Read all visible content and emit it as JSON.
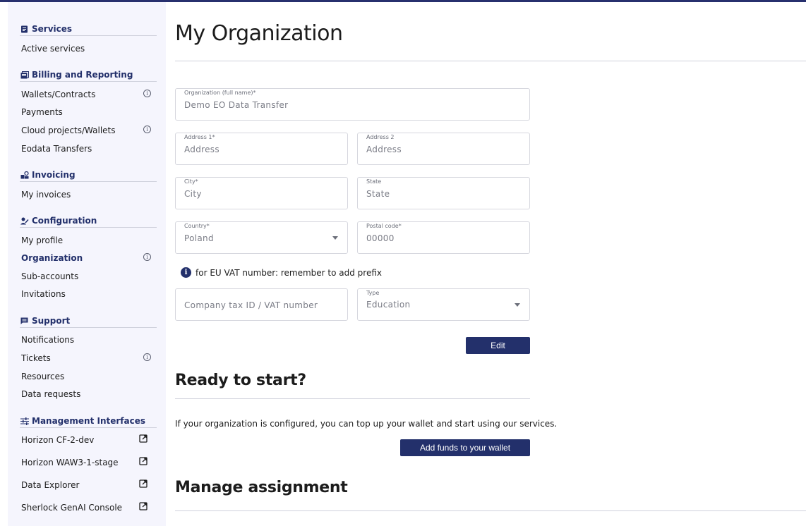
{
  "sidebar": {
    "sections": [
      {
        "title": "Services",
        "icon": "services-icon",
        "items": [
          {
            "label": "Active services"
          }
        ]
      },
      {
        "title": "Billing and Reporting",
        "icon": "billing-icon",
        "items": [
          {
            "label": "Wallets/Contracts",
            "info": true
          },
          {
            "label": "Payments"
          },
          {
            "label": "Cloud projects/Wallets",
            "info": true
          },
          {
            "label": "Eodata Transfers"
          }
        ]
      },
      {
        "title": "Invoicing",
        "icon": "invoicing-icon",
        "items": [
          {
            "label": "My invoices"
          }
        ]
      },
      {
        "title": "Configuration",
        "icon": "configuration-icon",
        "items": [
          {
            "label": "My profile"
          },
          {
            "label": "Organization",
            "info": true,
            "active": true
          },
          {
            "label": "Sub-accounts"
          },
          {
            "label": "Invitations"
          }
        ]
      },
      {
        "title": "Support",
        "icon": "support-icon",
        "items": [
          {
            "label": "Notifications"
          },
          {
            "label": "Tickets",
            "info": true
          },
          {
            "label": "Resources"
          },
          {
            "label": "Data requests"
          }
        ]
      },
      {
        "title": "Management Interfaces",
        "icon": "sliders-icon",
        "items": [
          {
            "label": "Horizon CF-2-dev",
            "external": true
          },
          {
            "label": "Horizon WAW3-1-stage",
            "external": true
          },
          {
            "label": "Data Explorer",
            "external": true
          },
          {
            "label": "Sherlock GenAI Console",
            "external": true
          }
        ]
      }
    ],
    "info_glyph": "i"
  },
  "main": {
    "title": "My Organization",
    "form": {
      "org_name": {
        "label": "Organization (full name)*",
        "value": "Demo EO Data Transfer"
      },
      "address1": {
        "label": "Address 1*",
        "placeholder": "Address"
      },
      "address2": {
        "label": "Address 2",
        "placeholder": "Address"
      },
      "city": {
        "label": "City*",
        "placeholder": "City"
      },
      "state": {
        "label": "State",
        "placeholder": "State"
      },
      "country": {
        "label": "Country*",
        "value": "Poland"
      },
      "postal": {
        "label": "Postal code*",
        "value": "00000"
      },
      "vat_note": "for EU VAT number: remember to add prefix",
      "tax_id": {
        "placeholder": "Company tax ID / VAT number"
      },
      "type": {
        "label": "Type",
        "value": "Education"
      },
      "edit_label": "Edit"
    },
    "ready": {
      "heading": "Ready to start?",
      "text": "If your organization is configured, you can top up your wallet and start using our services.",
      "button": "Add funds to your wallet"
    },
    "manage": {
      "heading": "Manage assignment"
    }
  },
  "colors": {
    "accent": "#23306b",
    "sidebar_bg": "#f5f5fd",
    "border": "#d6d7de"
  }
}
